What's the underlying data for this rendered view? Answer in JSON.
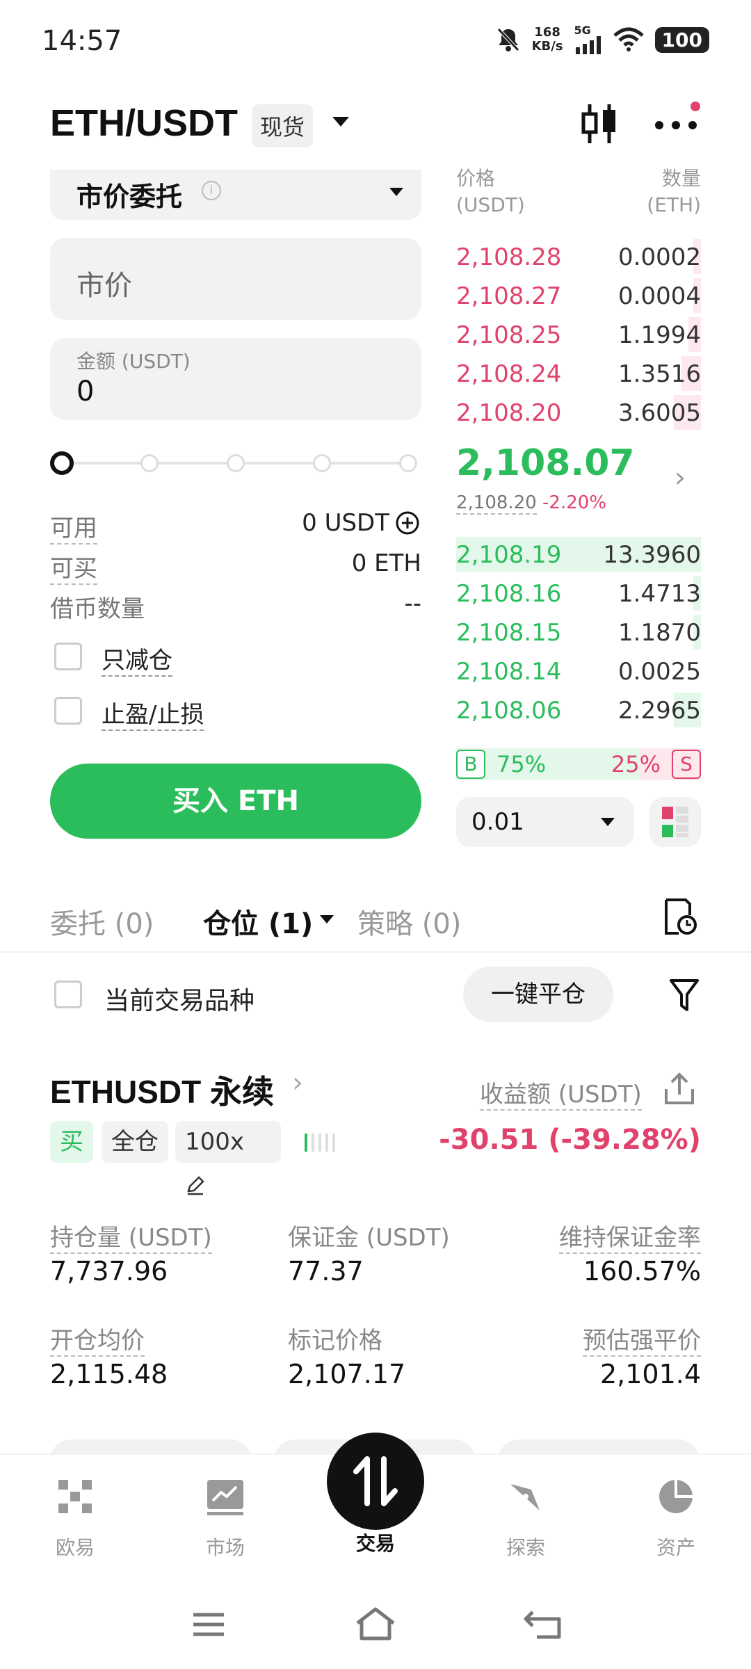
{
  "status_bar": {
    "time": "14:57",
    "net_speed_value": "168",
    "net_speed_unit": "KB/s",
    "network": "5G",
    "battery": "100",
    "icons": [
      "bell-off-icon",
      "signal-icon",
      "wifi-icon",
      "battery-icon"
    ]
  },
  "header": {
    "pair": "ETH/USDT",
    "market_tag": "现货",
    "icons": [
      "caret-down-icon",
      "candlestick-icon",
      "more-icon"
    ]
  },
  "order_form": {
    "order_type": "市价委托",
    "price_placeholder": "市价",
    "amount_label": "金额 (USDT)",
    "amount_value": "0",
    "slider_percent": 0,
    "available_label": "可用",
    "available_value": "0 USDT",
    "buyable_label": "可买",
    "buyable_value": "0 ETH",
    "borrow_label": "借币数量",
    "borrow_value": "--",
    "reduce_only_label": "只减仓",
    "tpsl_label": "止盈/止损",
    "buy_button": "买入 ETH"
  },
  "order_book": {
    "price_header": "价格",
    "price_unit": "(USDT)",
    "qty_header": "数量",
    "qty_unit": "(ETH)",
    "asks": [
      {
        "price": "2,108.28",
        "qty": "0.0002",
        "depth": 0.03
      },
      {
        "price": "2,108.27",
        "qty": "0.0004",
        "depth": 0.03
      },
      {
        "price": "2,108.25",
        "qty": "1.1994",
        "depth": 0.05
      },
      {
        "price": "2,108.24",
        "qty": "1.3516",
        "depth": 0.08
      },
      {
        "price": "2,108.20",
        "qty": "3.6005",
        "depth": 0.11
      }
    ],
    "last_price": "2,108.07",
    "mark_price": "2,108.20",
    "change": "-2.20%",
    "bids": [
      {
        "price": "2,108.19",
        "qty": "13.3960",
        "depth": 1.0
      },
      {
        "price": "2,108.16",
        "qty": "1.4713",
        "depth": 0.03
      },
      {
        "price": "2,108.15",
        "qty": "1.1870",
        "depth": 0.03
      },
      {
        "price": "2,108.14",
        "qty": "0.0025",
        "depth": 0.0
      },
      {
        "price": "2,108.06",
        "qty": "2.2965",
        "depth": 0.11
      }
    ],
    "buy_ratio_label": "B",
    "buy_ratio": "75%",
    "sell_ratio_label": "S",
    "sell_ratio": "25%",
    "buy_ratio_value": 0.75,
    "precision": "0.01"
  },
  "tabs": {
    "orders": "委托 (0)",
    "positions": "仓位 (1)",
    "strategies": "策略 (0)"
  },
  "filter": {
    "current_symbol_label": "当前交易品种",
    "close_all": "一键平仓"
  },
  "position": {
    "symbol": "ETHUSDT 永续",
    "pnl_label": "收益额 (USDT)",
    "side": "买",
    "margin_mode": "全仓",
    "leverage": "100x",
    "pnl_value": "-30.51 (-39.28%)",
    "size_label": "持仓量 (USDT)",
    "size_value": "7,737.96",
    "margin_label": "保证金 (USDT)",
    "margin_value": "77.37",
    "mmr_label": "维持保证金率",
    "mmr_value": "160.57%",
    "entry_label": "开仓均价",
    "entry_value": "2,115.48",
    "mark_label": "标记价格",
    "mark_value": "2,107.17",
    "liq_label": "预估强平价",
    "liq_value": "2,101.4"
  },
  "bottom_nav": {
    "items": [
      "欧易",
      "市场",
      "交易",
      "探索",
      "资产"
    ],
    "active": "交易"
  },
  "colors": {
    "green": "#2bbd5c",
    "red": "#e0426c"
  }
}
